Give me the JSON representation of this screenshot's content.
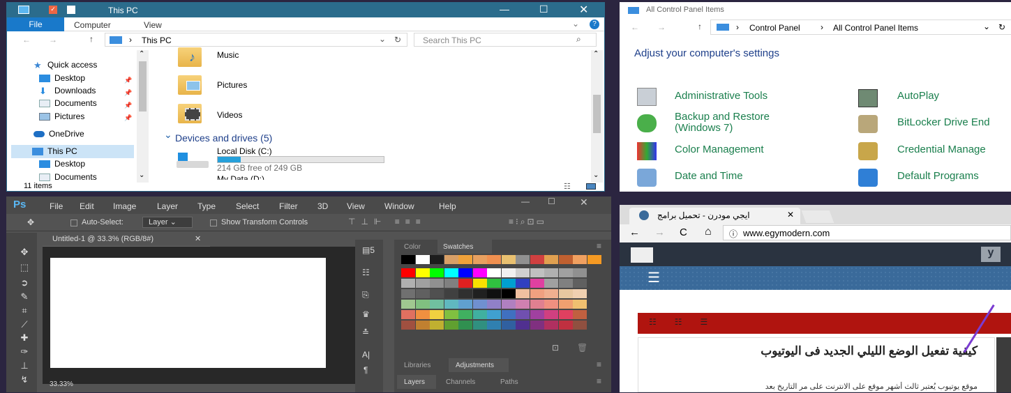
{
  "explorer": {
    "title": "This PC",
    "tabs": [
      "File",
      "Computer",
      "View"
    ],
    "path_root": "This PC",
    "search_placeholder": "Search This PC",
    "nav": {
      "quick_access": "Quick access",
      "items": [
        "Desktop",
        "Downloads",
        "Documents",
        "Pictures"
      ],
      "onedrive": "OneDrive",
      "thispc": "This PC",
      "sub": [
        "Desktop",
        "Documents"
      ]
    },
    "folders": [
      "Music",
      "Pictures",
      "Videos"
    ],
    "section": "Devices and drives (5)",
    "drive_name": "Local Disk (C:)",
    "drive_free": "214 GB free of 249 GB",
    "drive_fraction": 0.14,
    "drive2": "My Data (D:)",
    "status": "11 items"
  },
  "control_panel": {
    "title": "All Control Panel Items",
    "crumbs": [
      "Control Panel",
      "All Control Panel Items"
    ],
    "heading": "Adjust your computer's settings",
    "items_left": [
      "Administrative Tools",
      "Backup and Restore (Windows 7)",
      "Color Management",
      "Date and Time"
    ],
    "items_right": [
      "AutoPlay",
      "BitLocker Drive End",
      "Credential Manage",
      "Default Programs"
    ]
  },
  "photoshop": {
    "logo": "Ps",
    "menu": [
      "File",
      "Edit",
      "Image",
      "Layer",
      "Type",
      "Select",
      "Filter",
      "3D",
      "View",
      "Window",
      "Help"
    ],
    "options": {
      "auto_select": "Auto-Select:",
      "layer": "Layer",
      "transform": "Show Transform Controls"
    },
    "doc_tab": "Untitled-1 @ 33.3% (RGB/8#)",
    "zoom": "33.33%",
    "panel_tabs": [
      "Color",
      "Swatches"
    ],
    "panel_tabs2": [
      "Libraries",
      "Adjustments"
    ],
    "panel_tabs3": [
      "Layers",
      "Channels",
      "Paths"
    ]
  },
  "chrome": {
    "tab_title": "ايجي مودرن - تحميل برامج",
    "url": "www.egymodern.com",
    "article_title": "كيفية تفعيل الوضع الليلي الجديد فى اليوتيوب",
    "article_text": "موقع يوتيوب يُعتبر ثالث أشهر موقع على الانترنت على مر التاريخ بعد"
  },
  "colors": {
    "explorer_titlebar": "#2b6c8c",
    "ps_bg": "#535353",
    "site_red": "#b0140f",
    "site_blue": "#3a6a9a",
    "cp_link": "#1a7f4d"
  }
}
